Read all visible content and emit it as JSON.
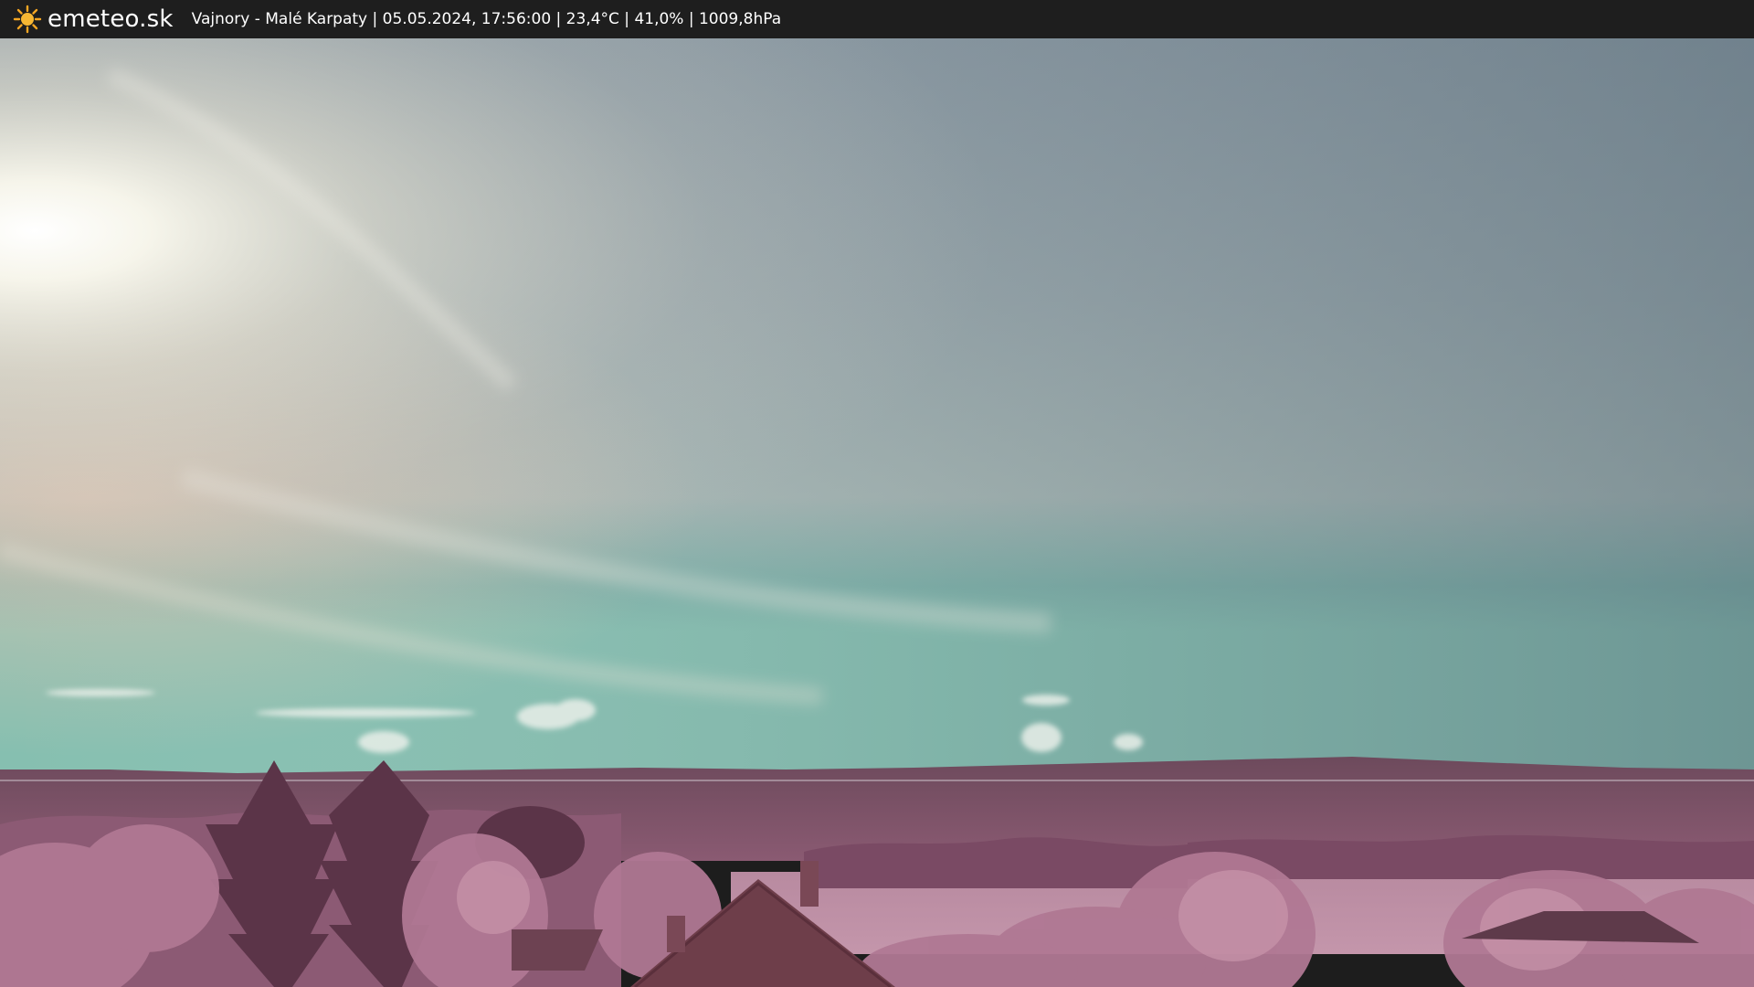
{
  "header": {
    "brand": "emeteo.sk",
    "caption": "Vajnory - Malé Karpaty | 05.05.2024, 17:56:00 | 23,4°C | 41,0% | 1009,8hPa",
    "icon": "sun-icon"
  },
  "colors": {
    "bar_background": "#1e1e1e",
    "sun": "#f5a623",
    "sky_top": "#6a7b86",
    "sky_horizon": "#76b6a8",
    "hills": "#7a4d63",
    "foliage": "#a46b86"
  }
}
